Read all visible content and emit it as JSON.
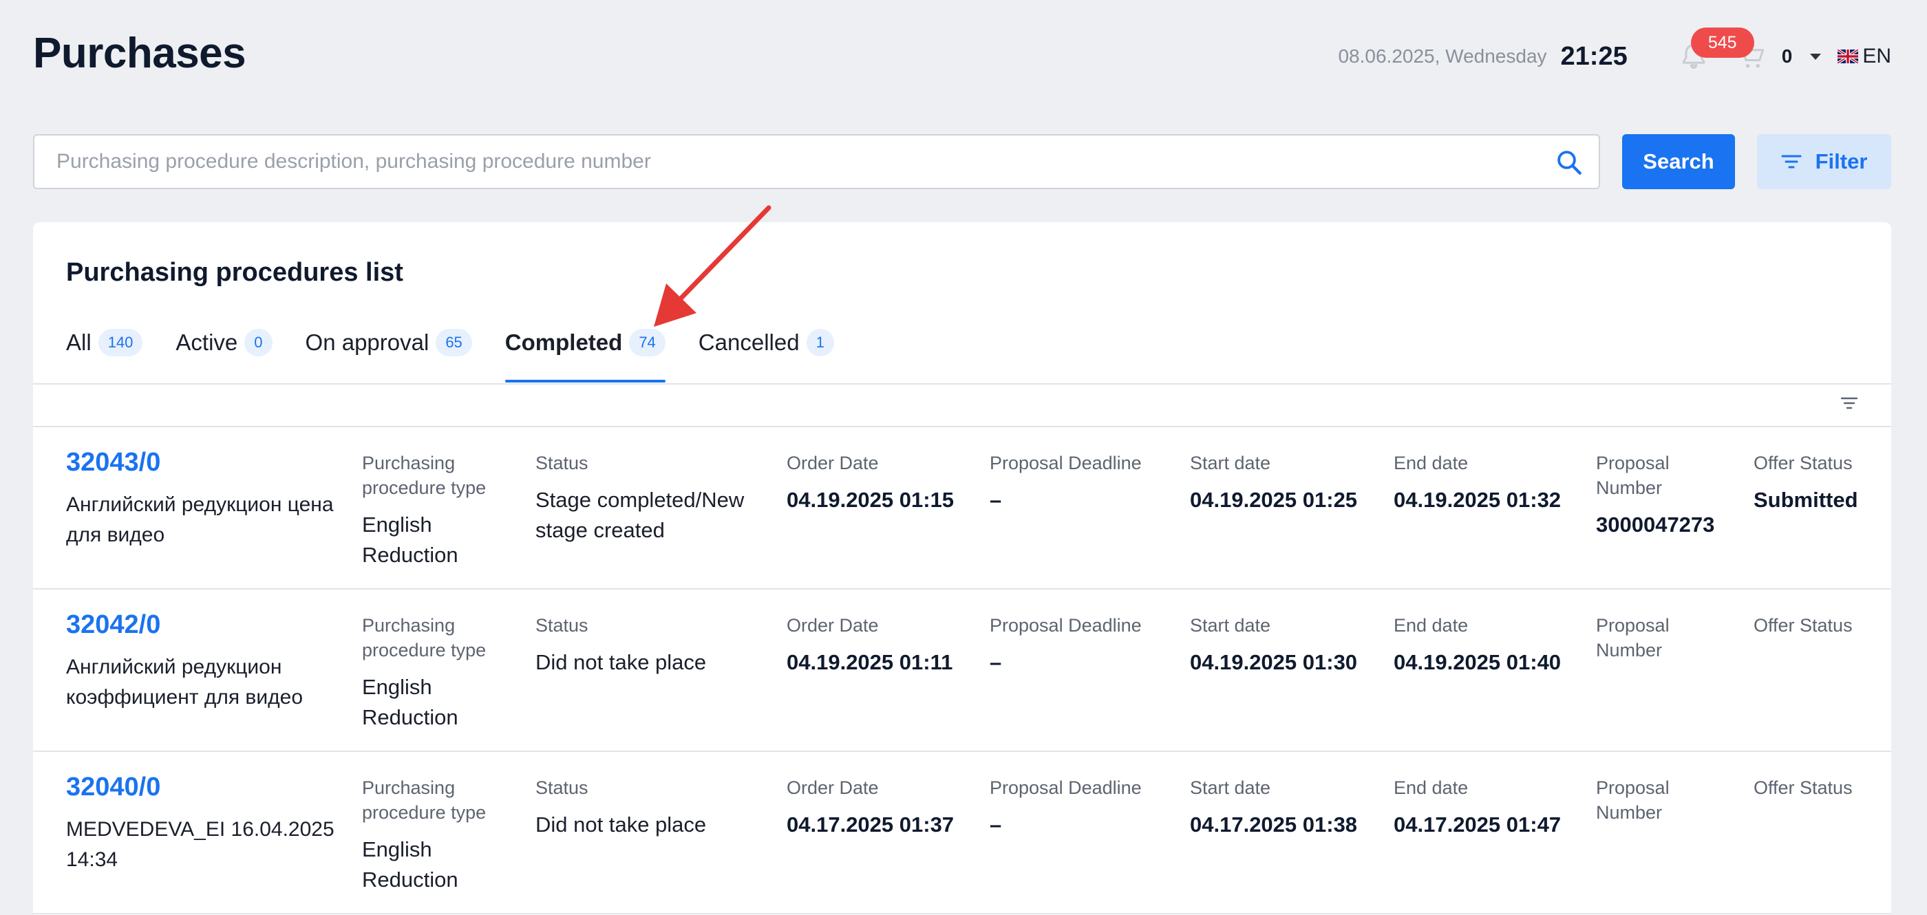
{
  "header": {
    "title": "Purchases",
    "date": "08.06.2025, Wednesday",
    "time": "21:25",
    "notification_count": "545",
    "cart_count": "0",
    "language": "EN"
  },
  "search": {
    "placeholder": "Purchasing procedure description, purchasing procedure number",
    "value": "",
    "search_label": "Search",
    "filter_label": "Filter"
  },
  "list": {
    "title": "Purchasing procedures list",
    "tabs": [
      {
        "label": "All",
        "count": "140",
        "active": false
      },
      {
        "label": "Active",
        "count": "0",
        "active": false
      },
      {
        "label": "On approval",
        "count": "65",
        "active": false
      },
      {
        "label": "Completed",
        "count": "74",
        "active": true
      },
      {
        "label": "Cancelled",
        "count": "1",
        "active": false
      }
    ],
    "columns": {
      "type": "Purchasing procedure type",
      "status": "Status",
      "order_date": "Order Date",
      "proposal_deadline": "Proposal Deadline",
      "start_date": "Start date",
      "end_date": "End date",
      "proposal_number": "Proposal Number",
      "offer_status": "Offer Status"
    },
    "rows": [
      {
        "number": "32043/0",
        "description": "Английский редукцион цена для видео",
        "type": "English Reduction",
        "status": "Stage completed/New stage created",
        "order_date": "04.19.2025 01:15",
        "proposal_deadline": "–",
        "start_date": "04.19.2025 01:25",
        "end_date": "04.19.2025 01:32",
        "proposal_number": "3000047273",
        "offer_status": "Submitted"
      },
      {
        "number": "32042/0",
        "description": "Английский редукцион коэффициент для видео",
        "type": "English Reduction",
        "status": "Did not take place",
        "order_date": "04.19.2025 01:11",
        "proposal_deadline": "–",
        "start_date": "04.19.2025 01:30",
        "end_date": "04.19.2025 01:40",
        "proposal_number": "",
        "offer_status": ""
      },
      {
        "number": "32040/0",
        "description": "MEDVEDEVA_EI 16.04.2025 14:34",
        "type": "English Reduction",
        "status": "Did not take place",
        "order_date": "04.17.2025 01:37",
        "proposal_deadline": "–",
        "start_date": "04.17.2025 01:38",
        "end_date": "04.17.2025 01:47",
        "proposal_number": "",
        "offer_status": ""
      }
    ]
  },
  "colors": {
    "accent": "#1a73f0",
    "badge": "#f04b4b",
    "annotation_arrow": "#e53935"
  }
}
